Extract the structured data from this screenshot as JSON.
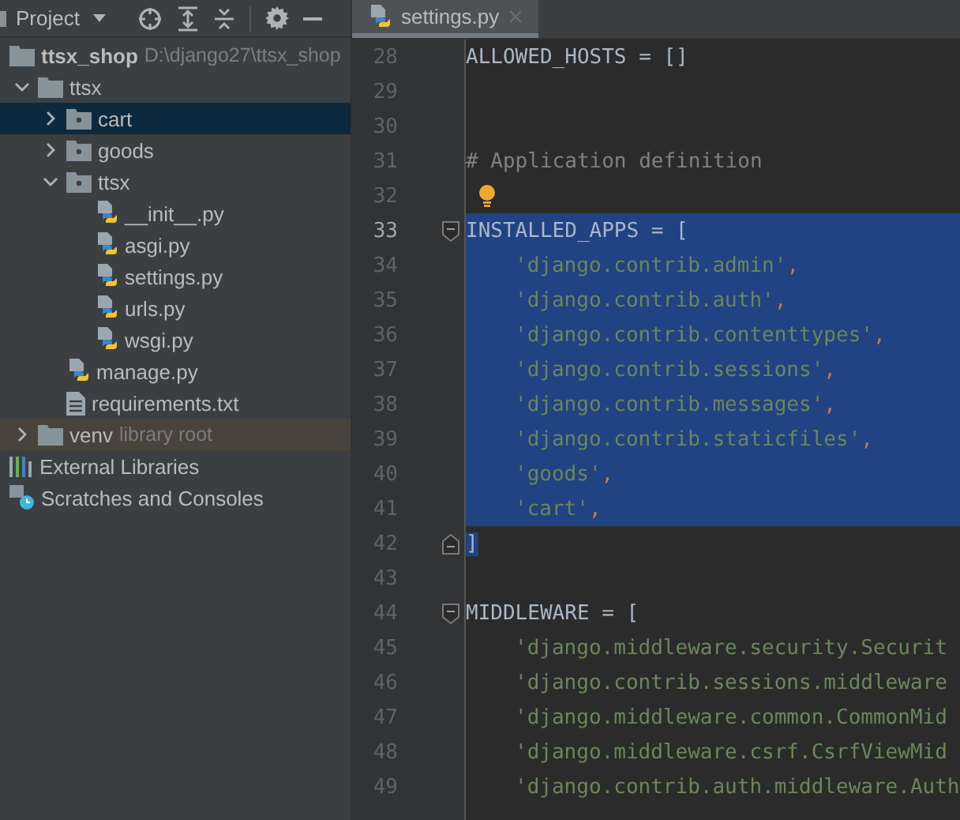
{
  "project_panel": {
    "title": "Project",
    "tree": [
      {
        "label": "ttsx_shop",
        "path": "D:\\django27\\ttsx_shop",
        "kind": "root",
        "selected": false,
        "children": [
          {
            "label": "ttsx",
            "kind": "folder",
            "expanded": true,
            "selected": false,
            "children": [
              {
                "label": "cart",
                "kind": "package",
                "expanded": false,
                "selected": true
              },
              {
                "label": "goods",
                "kind": "package",
                "expanded": false,
                "selected": false
              },
              {
                "label": "ttsx",
                "kind": "package",
                "expanded": true,
                "selected": false,
                "children": [
                  {
                    "label": "__init__.py",
                    "kind": "python",
                    "selected": false
                  },
                  {
                    "label": "asgi.py",
                    "kind": "python",
                    "selected": false
                  },
                  {
                    "label": "settings.py",
                    "kind": "python",
                    "selected": false
                  },
                  {
                    "label": "urls.py",
                    "kind": "python",
                    "selected": false
                  },
                  {
                    "label": "wsgi.py",
                    "kind": "python",
                    "selected": false
                  }
                ]
              },
              {
                "label": "manage.py",
                "kind": "python",
                "selected": false
              },
              {
                "label": "requirements.txt",
                "kind": "text",
                "selected": false
              }
            ]
          },
          {
            "label": "venv",
            "hint": "library root",
            "kind": "library-folder",
            "expanded": false,
            "selected": false
          }
        ]
      },
      {
        "label": "External Libraries",
        "kind": "libraries",
        "selected": false
      },
      {
        "label": "Scratches and Consoles",
        "kind": "scratches",
        "selected": false
      }
    ]
  },
  "editor": {
    "tabs": [
      {
        "label": "settings.py",
        "selected": true
      }
    ],
    "lines": [
      {
        "number": "28",
        "tokens": [
          {
            "kind": "code",
            "text": "ALLOWED_HOSTS = []"
          }
        ]
      },
      {
        "number": "29"
      },
      {
        "number": "30"
      },
      {
        "number": "31",
        "tokens": [
          {
            "kind": "comment",
            "text": "# Application definition"
          }
        ]
      },
      {
        "number": "32",
        "bulb": true
      },
      {
        "number": "33",
        "current": true,
        "selected": true,
        "fold_start": true,
        "tokens": [
          {
            "kind": "code",
            "text": "INSTALLED_APPS = ["
          }
        ]
      },
      {
        "number": "34",
        "selected": true,
        "indented": true,
        "tokens": [
          {
            "kind": "string",
            "text": "'django.contrib.admin'"
          },
          {
            "kind": "comma",
            "text": ","
          }
        ]
      },
      {
        "number": "35",
        "selected": true,
        "indented": true,
        "tokens": [
          {
            "kind": "string",
            "text": "'django.contrib.auth'"
          },
          {
            "kind": "comma",
            "text": ","
          }
        ]
      },
      {
        "number": "36",
        "selected": true,
        "indented": true,
        "tokens": [
          {
            "kind": "string",
            "text": "'django.contrib.contenttypes'"
          },
          {
            "kind": "comma",
            "text": ","
          }
        ]
      },
      {
        "number": "37",
        "selected": true,
        "indented": true,
        "tokens": [
          {
            "kind": "string",
            "text": "'django.contrib.sessions'"
          },
          {
            "kind": "comma",
            "text": ","
          }
        ]
      },
      {
        "number": "38",
        "selected": true,
        "indented": true,
        "tokens": [
          {
            "kind": "string",
            "text": "'django.contrib.messages'"
          },
          {
            "kind": "comma",
            "text": ","
          }
        ]
      },
      {
        "number": "39",
        "selected": true,
        "indented": true,
        "tokens": [
          {
            "kind": "string",
            "text": "'django.contrib.staticfiles'"
          },
          {
            "kind": "comma",
            "text": ","
          }
        ]
      },
      {
        "number": "40",
        "selected": true,
        "indented": true,
        "tokens": [
          {
            "kind": "string",
            "text": "'goods'"
          },
          {
            "kind": "comma",
            "text": ","
          }
        ]
      },
      {
        "number": "41",
        "selected": true,
        "indented": true,
        "tokens": [
          {
            "kind": "string",
            "text": "'cart'"
          },
          {
            "kind": "comma",
            "text": ","
          }
        ]
      },
      {
        "number": "42",
        "fold_end": true,
        "tokens": [
          {
            "kind": "code",
            "text": "]",
            "selected": true
          }
        ]
      },
      {
        "number": "43"
      },
      {
        "number": "44",
        "fold_start": true,
        "tokens": [
          {
            "kind": "code",
            "text": "MIDDLEWARE = ["
          }
        ]
      },
      {
        "number": "45",
        "indented": true,
        "tokens": [
          {
            "kind": "string",
            "text": "'django.middleware.security.Securit"
          }
        ]
      },
      {
        "number": "46",
        "indented": true,
        "tokens": [
          {
            "kind": "string",
            "text": "'django.contrib.sessions.middleware"
          }
        ]
      },
      {
        "number": "47",
        "indented": true,
        "tokens": [
          {
            "kind": "string",
            "text": "'django.middleware.common.CommonMid"
          }
        ]
      },
      {
        "number": "48",
        "indented": true,
        "tokens": [
          {
            "kind": "string",
            "text": "'django.middleware.csrf.CsrfViewMid"
          }
        ]
      },
      {
        "number": "49",
        "indented": true,
        "tokens": [
          {
            "kind": "string",
            "text": "'django.contrib.auth.middleware.Auth"
          }
        ]
      }
    ]
  }
}
